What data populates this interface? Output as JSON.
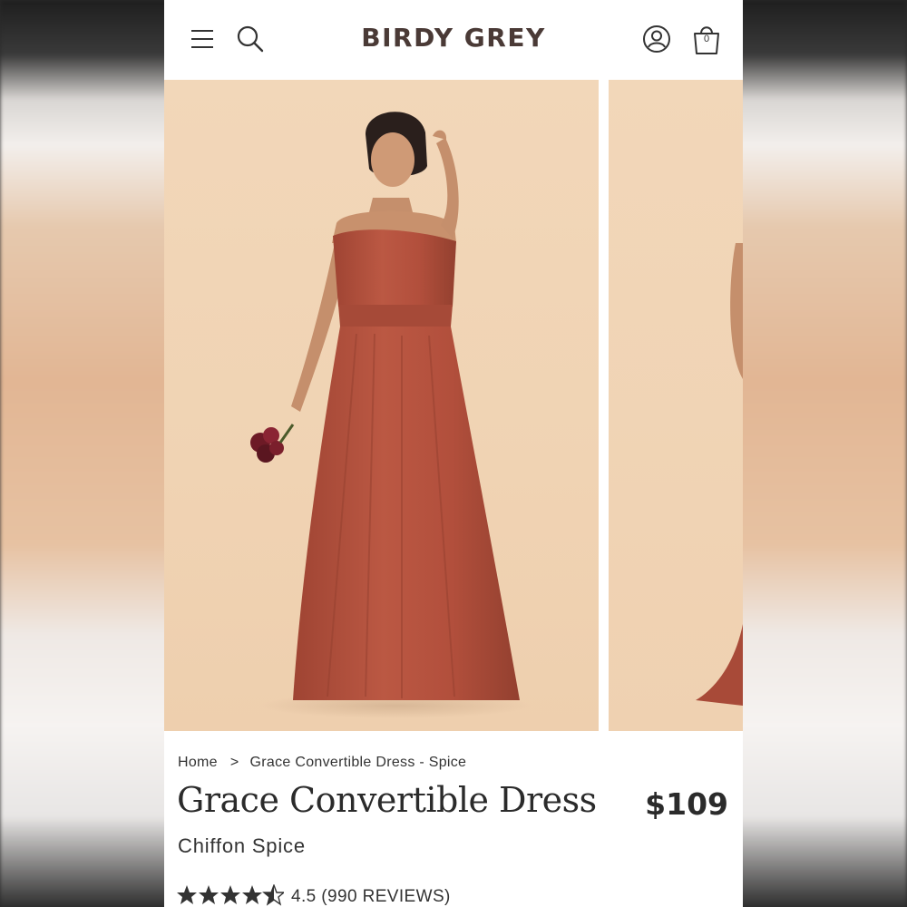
{
  "header": {
    "logo": "BIRDY GREY",
    "cart_count": "0",
    "icons": [
      "menu-icon",
      "search-icon",
      "account-icon",
      "cart-icon"
    ]
  },
  "gallery": {
    "images": [
      "dress-model-front-photo",
      "dress-model-side-photo"
    ],
    "dress_color": "#b5523f",
    "background_color": "#f1d5b6"
  },
  "breadcrumb": {
    "home": "Home",
    "separator": ">",
    "current": "Grace Convertible Dress - Spice"
  },
  "product": {
    "title": "Grace Convertible Dress",
    "price": "$109",
    "subtitle": "Chiffon Spice",
    "rating_value": 4.5,
    "rating_text": "4.5 (990 REVIEWS)"
  }
}
